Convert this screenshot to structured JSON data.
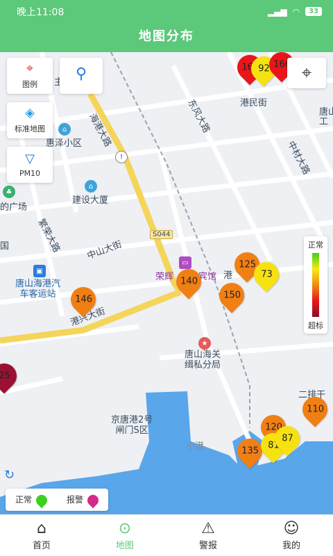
{
  "status": {
    "time": "晚上11:08",
    "signal": "▮▮▮",
    "wifi": "◔",
    "battery": "33"
  },
  "header": {
    "title": "地图分布"
  },
  "tools": {
    "legend": "图例",
    "standard_map": "标准地图",
    "pm10": "PM10"
  },
  "map_labels": {
    "huize": "惠泽小区",
    "jianshe": "建设大厦",
    "square": "的广场",
    "haigang_road": "海港大路",
    "dongfeng_road": "东风大路",
    "gangmin_street": "港民街",
    "zhongcai_road": "中材大路",
    "zhongshan_street": "中山大街",
    "fanrong_road": "繁荣大路",
    "bus_station": "唐山海港汽\n车客运站",
    "ronghui_hotel": "荣辉",
    "hotel_tail": "宾馆",
    "s044": "S044",
    "gangxing_street": "港兴大街",
    "customs": "唐山海关\n缉私分局",
    "port_gate": "京唐港2号\n闸门S区",
    "xiaogang": "小港",
    "erpai": "二排干",
    "tangshan_edge": "唐山\n工",
    "zhu": "主",
    "gang": "港",
    "jiang": "港",
    "guo": "国"
  },
  "aqi_markers": [
    {
      "value": "167",
      "level": "red"
    },
    {
      "value": "92",
      "level": "yellow"
    },
    {
      "value": "166",
      "level": "red"
    },
    {
      "value": "125",
      "level": "orange"
    },
    {
      "value": "73",
      "level": "yellow"
    },
    {
      "value": "140",
      "level": "orange"
    },
    {
      "value": "150",
      "level": "orange"
    },
    {
      "value": "146",
      "level": "orange"
    },
    {
      "value": "25",
      "level": "dark"
    },
    {
      "value": "110",
      "level": "orange"
    },
    {
      "value": "120",
      "level": "orange"
    },
    {
      "value": "135",
      "level": "orange"
    },
    {
      "value": "81",
      "level": "yellow"
    },
    {
      "value": "87",
      "level": "yellow"
    }
  ],
  "legend_bar": {
    "top": "正常",
    "bottom": "超标"
  },
  "legend_bottom": {
    "normal": "正常",
    "alarm": "报警"
  },
  "colors": {
    "brand": "#5cc87a",
    "normal_dot": "#3fd01f",
    "alarm_dot": "#d6288b"
  },
  "nav": [
    {
      "label": "首页",
      "icon": "home-icon"
    },
    {
      "label": "地图",
      "icon": "map-pin-icon"
    },
    {
      "label": "警报",
      "icon": "siren-icon"
    },
    {
      "label": "我的",
      "icon": "users-icon"
    }
  ]
}
